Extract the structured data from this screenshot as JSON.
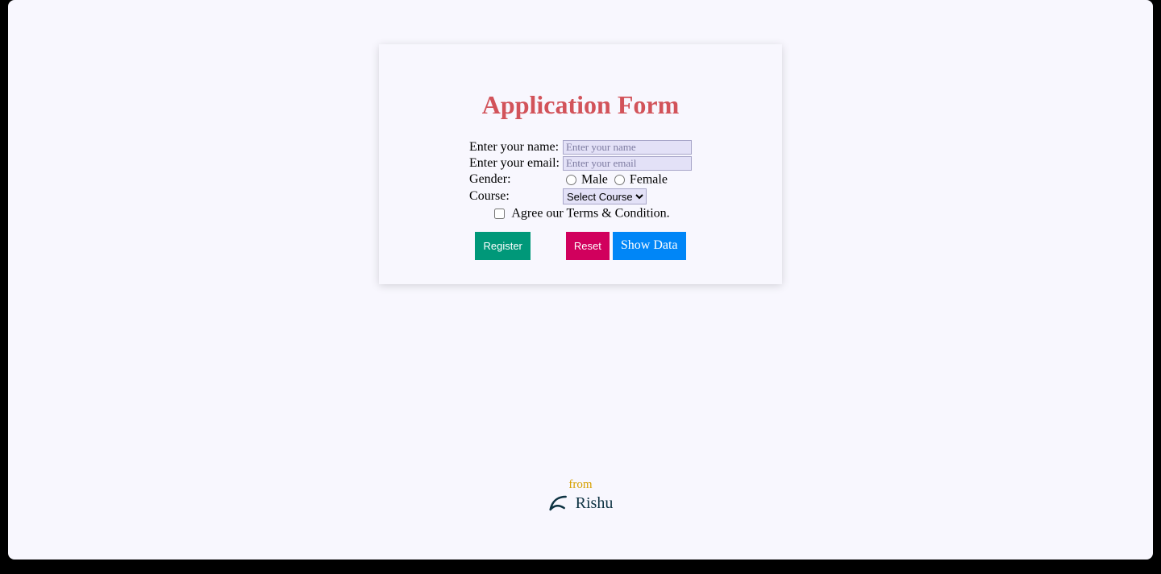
{
  "form": {
    "title": "Application Form",
    "name": {
      "label": "Enter your name:",
      "placeholder": "Enter your name",
      "value": ""
    },
    "email": {
      "label": "Enter your email:",
      "placeholder": "Enter your email",
      "value": ""
    },
    "gender": {
      "label": "Gender:",
      "male": "Male",
      "female": "Female"
    },
    "course": {
      "label": "Course:",
      "selected": "Select Course"
    },
    "terms": {
      "label": "Agree our Terms & Condition."
    },
    "buttons": {
      "register": "Register",
      "reset": "Reset",
      "show": "Show Data"
    }
  },
  "footer": {
    "from": "from",
    "name": "Rishu"
  }
}
